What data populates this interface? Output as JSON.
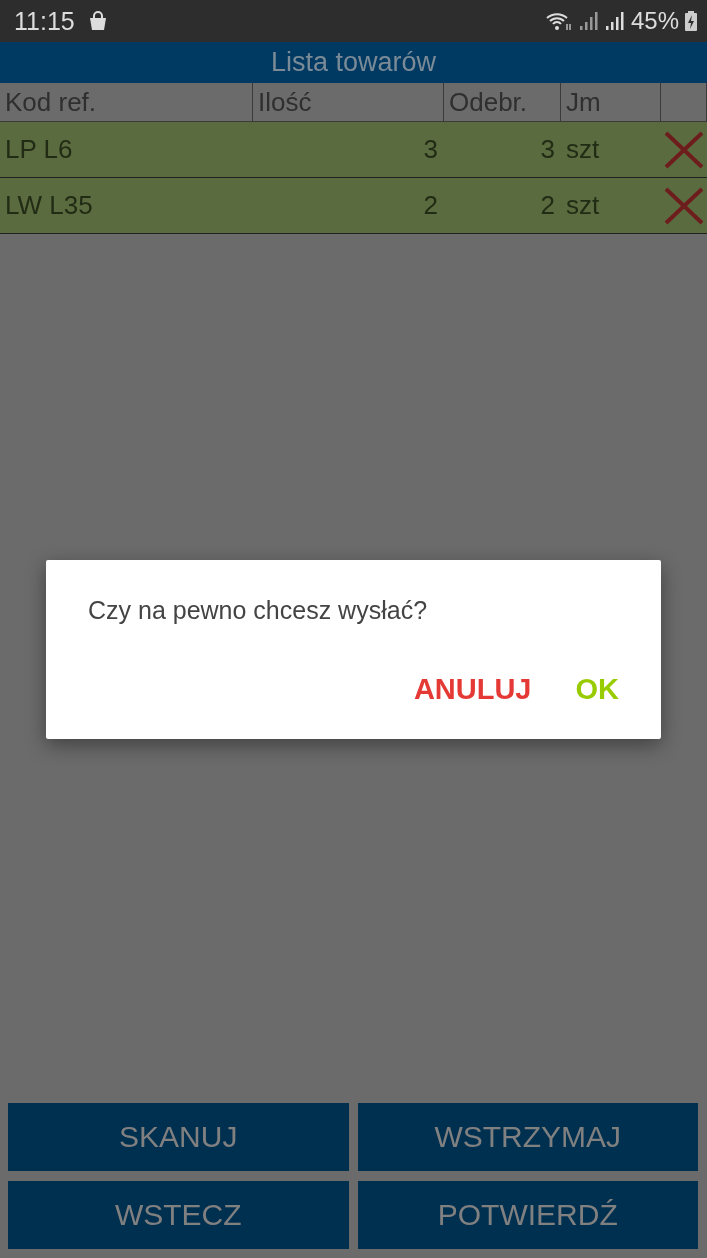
{
  "status_bar": {
    "time": "11:15",
    "battery": "45%"
  },
  "title": "Lista towarów",
  "table": {
    "columns": [
      "Kod ref.",
      "Ilość",
      "Odebr.",
      "Jm"
    ],
    "rows": [
      {
        "code": "LP L6",
        "qty": "3",
        "received": "3",
        "unit": "szt"
      },
      {
        "code": "LW L35",
        "qty": "2",
        "received": "2",
        "unit": "szt"
      }
    ]
  },
  "buttons": [
    "SKANUJ",
    "WSTRZYMAJ",
    "WSTECZ",
    "POTWIERDŹ"
  ],
  "dialog": {
    "message": "Czy na pewno chcesz wysłać?",
    "buttons": [
      {
        "label": "ANULUJ",
        "kind": "negative"
      },
      {
        "label": "OK",
        "kind": "positive"
      }
    ]
  }
}
